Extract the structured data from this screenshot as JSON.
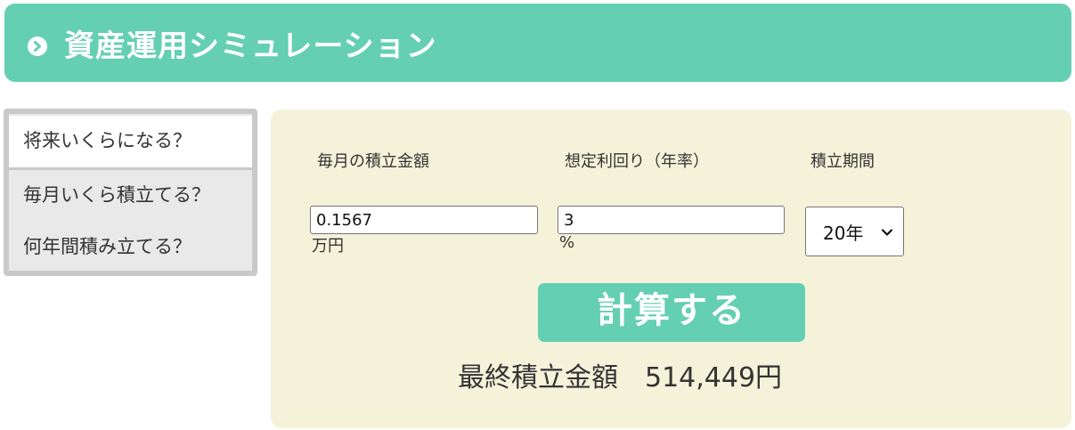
{
  "header": {
    "title": "資産運用シミュレーション",
    "icon": "chevron-right-circle-icon"
  },
  "tabs": [
    {
      "label": "将来いくらになる？",
      "active": true
    },
    {
      "label": "毎月いくら積立てる？",
      "active": false
    },
    {
      "label": "何年間積み立てる？",
      "active": false
    }
  ],
  "form": {
    "monthly_amount": {
      "label": "毎月の積立金額",
      "value": "0.1567",
      "unit": "万円"
    },
    "expected_return": {
      "label": "想定利回り（年率）",
      "value": "3",
      "unit": "%"
    },
    "period": {
      "label": "積立期間",
      "selected": "20年"
    }
  },
  "calculate_button": {
    "label": "計算する"
  },
  "result": {
    "label": "最終積立金額",
    "amount": "514,449円"
  },
  "colors": {
    "accent": "#64cfb1",
    "panel_background": "#f4f3da",
    "tab_background": "#e9e9e9",
    "tab_border": "#c9c9c9"
  }
}
